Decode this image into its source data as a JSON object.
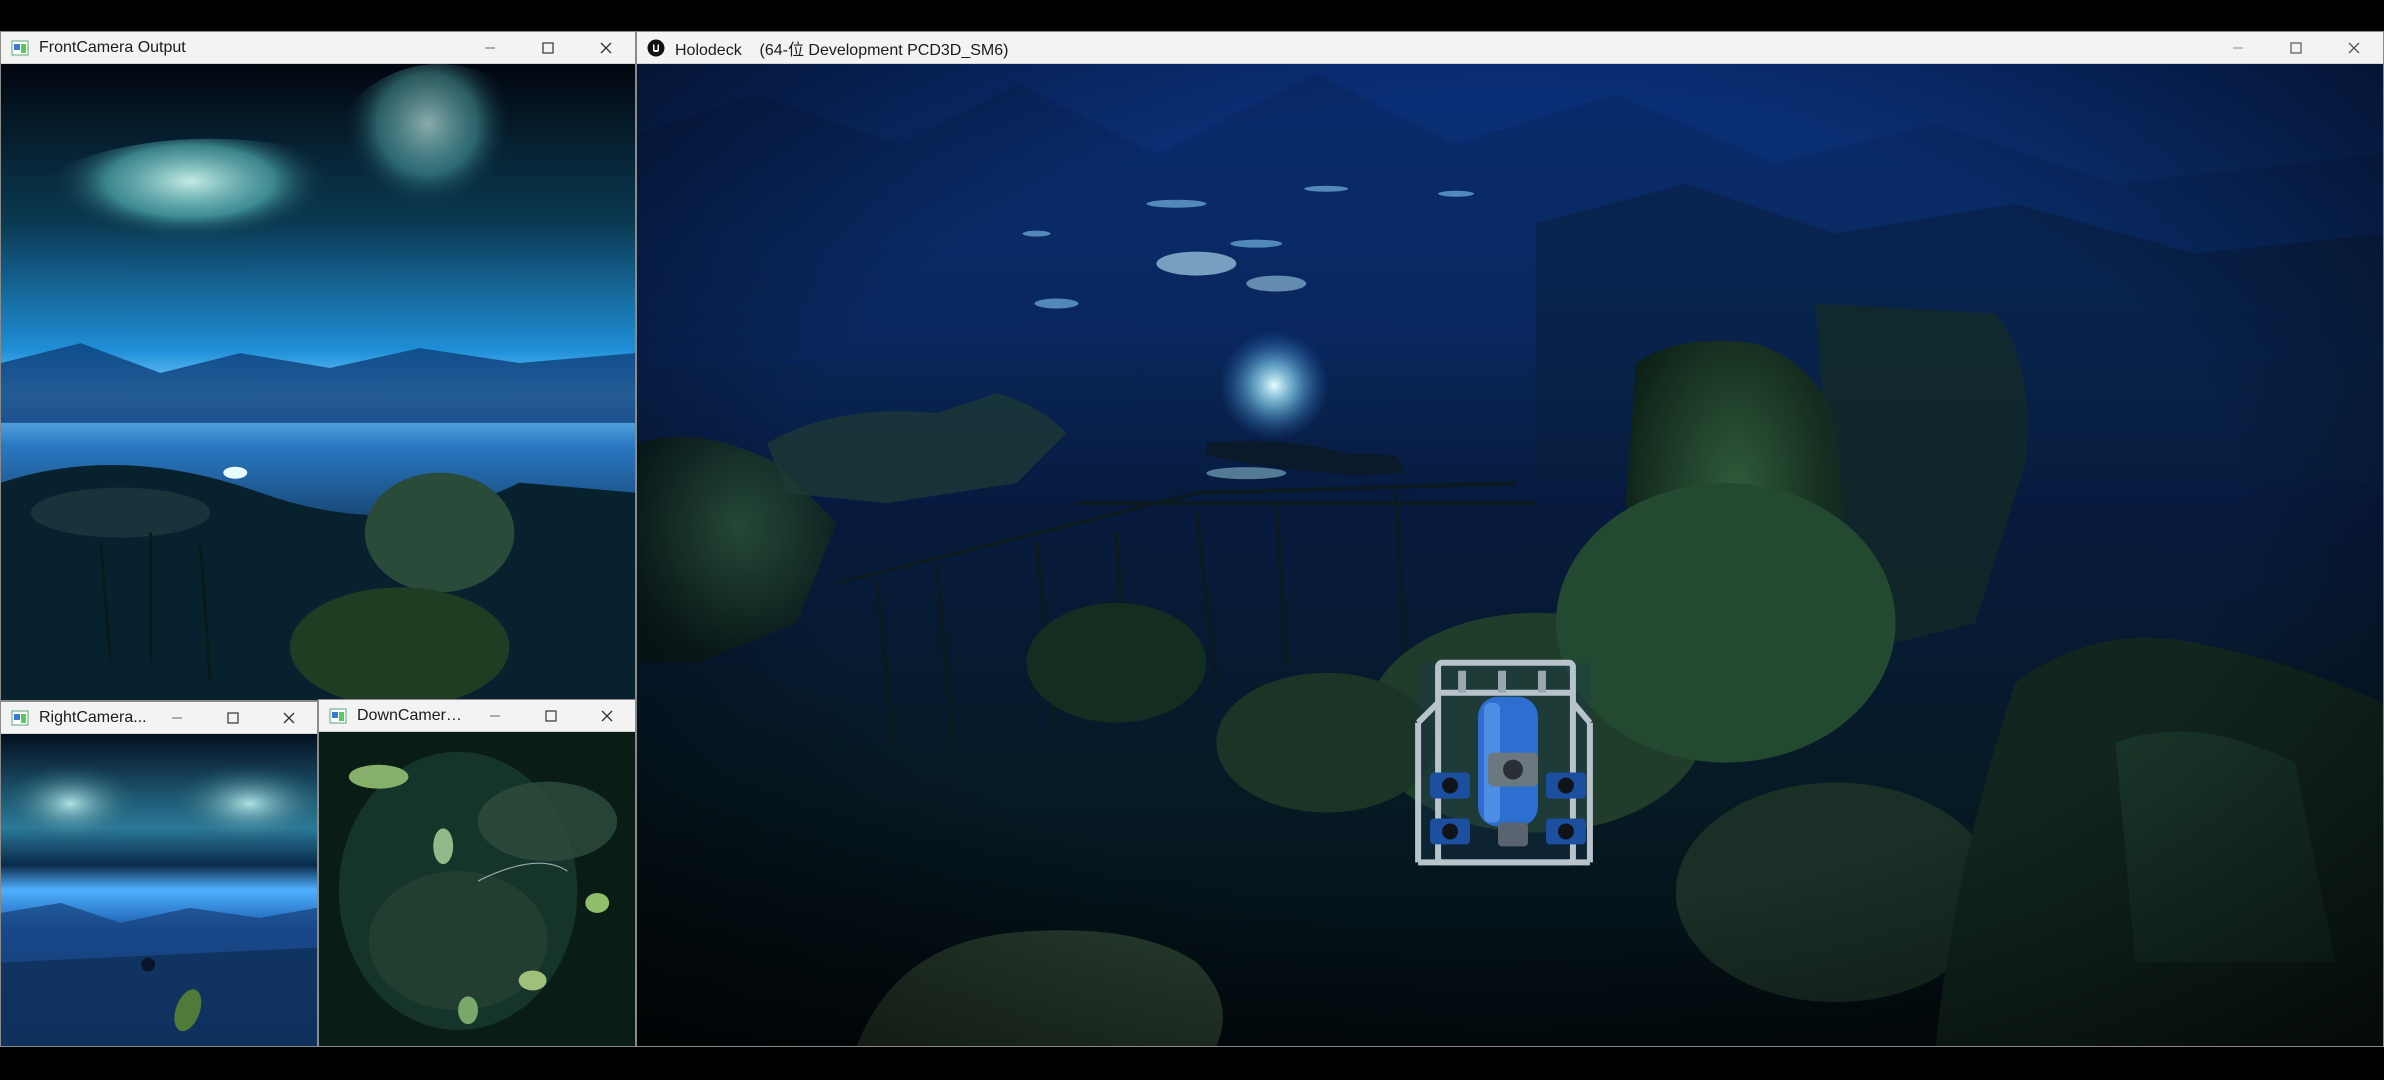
{
  "windows": {
    "front": {
      "title": "FrontCamera Output"
    },
    "holodeck": {
      "title": "Holodeck    (64-位 Development PCD3D_SM6)"
    },
    "right": {
      "title": "RightCamera..."
    },
    "down": {
      "title": "DownCamera..."
    }
  },
  "icons": {
    "app_icon": "opencv-window-icon",
    "unreal_icon": "unreal-engine-logo",
    "minimize": "minimize-icon",
    "maximize": "maximize-icon",
    "close": "close-icon"
  },
  "colors": {
    "ocean_deep": "#04102e",
    "ocean_mid": "#0b3a7a",
    "ocean_light": "#3fa9e6",
    "rock": "#1f3a2a",
    "rov_blue": "#2d6fd1",
    "titlebar": "#f3f3f3"
  }
}
